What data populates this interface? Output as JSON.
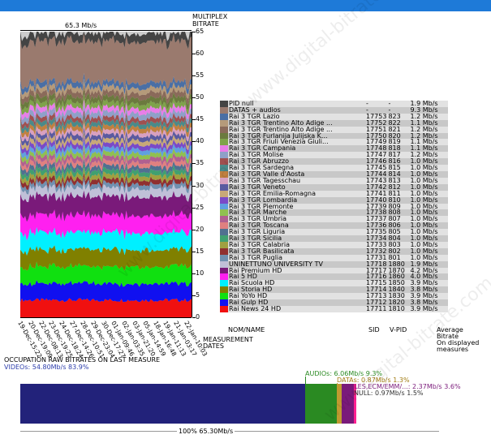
{
  "peak": "65.3 Mb/s",
  "chart_title": [
    "MULTIPLEX",
    "BITRATE"
  ],
  "y_ticks": [
    "0",
    "5",
    "10",
    "15",
    "20",
    "25",
    "30",
    "35",
    "40",
    "45",
    "50",
    "55",
    "60",
    "65"
  ],
  "dates": [
    "19-Dec-15:22",
    "20-Dec-19:09",
    "22-Dec-08:13",
    "23-Dec-19:25",
    "24-Dec-18:24",
    "27-Dec-14:26",
    "28-Dec-10:51",
    "29-Dec-23:04",
    "30-Dec-17:27",
    "01-Jan-09:46",
    "02-Jan-03:35",
    "03-Jan-21:20",
    "05-Jan-14:59",
    "18-Jan-16:48",
    "19-Jan-11:13",
    "21-Jan-03:17",
    "22-Jan-10:03"
  ],
  "measurement_dates": [
    "MEASUREMENT",
    "DATES"
  ],
  "legend": [
    {
      "color": "#444444",
      "name": "PID null",
      "sid": "-",
      "vpid": "-",
      "rate": "1.9 Mb/s"
    },
    {
      "color": "#9a7a6e",
      "name": "DATAS + audios",
      "sid": "-",
      "vpid": "-",
      "rate": "9.3 Mb/s"
    },
    {
      "color": "#4a6fa5",
      "name": "Rai 3 TGR Lazio",
      "sid": "17753",
      "vpid": "823",
      "rate": "1.2 Mb/s"
    },
    {
      "color": "#b59a7a",
      "name": "Rai 3 TGR Trentino Alto Adige ...",
      "sid": "17752",
      "vpid": "822",
      "rate": "1.1 Mb/s"
    },
    {
      "color": "#8a6a5a",
      "name": "Rai 3 TGR Trentino Alto Adige ...",
      "sid": "17751",
      "vpid": "821",
      "rate": "1.2 Mb/s"
    },
    {
      "color": "#6b7a3e",
      "name": "Rai 3 TGR Furlanija Julijska K...",
      "sid": "17750",
      "vpid": "820",
      "rate": "1.2 Mb/s"
    },
    {
      "color": "#7fa34a",
      "name": "Rai 3 TGR Friuli Venezia Giuli...",
      "sid": "17749",
      "vpid": "819",
      "rate": "1.1 Mb/s"
    },
    {
      "color": "#e87ee8",
      "name": "Rai 3 TGR Campania",
      "sid": "17748",
      "vpid": "818",
      "rate": "1.1 Mb/s"
    },
    {
      "color": "#8fa0c8",
      "name": "Rai 3 TGR Molise",
      "sid": "17747",
      "vpid": "817",
      "rate": "1.2 Mb/s"
    },
    {
      "color": "#a05050",
      "name": "Rai 3 TGR Abruzzo",
      "sid": "17746",
      "vpid": "816",
      "rate": "1.0 Mb/s"
    },
    {
      "color": "#4a8a8a",
      "name": "Rai 3 TGR Sardegna",
      "sid": "17745",
      "vpid": "815",
      "rate": "1.0 Mb/s"
    },
    {
      "color": "#c08040",
      "name": "Rai 3 TGR Valle d'Aosta",
      "sid": "17744",
      "vpid": "814",
      "rate": "1.0 Mb/s"
    },
    {
      "color": "#d8a0c0",
      "name": "Rai 3 TGR Tagesschau",
      "sid": "17743",
      "vpid": "813",
      "rate": "1.0 Mb/s"
    },
    {
      "color": "#5a5aa0",
      "name": "Rai 3 TGR Veneto",
      "sid": "17742",
      "vpid": "812",
      "rate": "1.0 Mb/s"
    },
    {
      "color": "#c8a878",
      "name": "Rai 3 TGR Emilia-Romagna",
      "sid": "17741",
      "vpid": "811",
      "rate": "1.0 Mb/s"
    },
    {
      "color": "#7a4ac8",
      "name": "Rai 3 TGR Lombardia",
      "sid": "17740",
      "vpid": "810",
      "rate": "1.0 Mb/s"
    },
    {
      "color": "#60a0e0",
      "name": "Rai 3 TGR Piemonte",
      "sid": "17739",
      "vpid": "809",
      "rate": "1.0 Mb/s"
    },
    {
      "color": "#90c050",
      "name": "Rai 3 TGR Marche",
      "sid": "17738",
      "vpid": "808",
      "rate": "1.0 Mb/s"
    },
    {
      "color": "#b06090",
      "name": "Rai 3 TGR Umbria",
      "sid": "17737",
      "vpid": "807",
      "rate": "1.0 Mb/s"
    },
    {
      "color": "#e08080",
      "name": "Rai 3 TGR Toscana",
      "sid": "17736",
      "vpid": "806",
      "rate": "1.0 Mb/s"
    },
    {
      "color": "#507090",
      "name": "Rai 3 TGR Liguria",
      "sid": "17735",
      "vpid": "805",
      "rate": "1.0 Mb/s"
    },
    {
      "color": "#40a070",
      "name": "Rai 3 TGR Sicilia",
      "sid": "17734",
      "vpid": "804",
      "rate": "1.0 Mb/s"
    },
    {
      "color": "#a0a040",
      "name": "Rai 3 TGR Calabria",
      "sid": "17733",
      "vpid": "803",
      "rate": "1.0 Mb/s"
    },
    {
      "color": "#903030",
      "name": "Rai 3 TGR Basilicata",
      "sid": "17732",
      "vpid": "802",
      "rate": "1.0 Mb/s"
    },
    {
      "color": "#7090b0",
      "name": "Rai 3 TGR Puglia",
      "sid": "17731",
      "vpid": "801",
      "rate": "1.0 Mb/s"
    },
    {
      "color": "#c0c0d8",
      "name": "UNINETTUNO UNIVERSITY TV",
      "sid": "17718",
      "vpid": "1880",
      "rate": "1.9 Mb/s"
    },
    {
      "color": "#7a1a7a",
      "name": "Rai Premium HD",
      "sid": "17717",
      "vpid": "1870",
      "rate": "4.2 Mb/s"
    },
    {
      "color": "#ff20f0",
      "name": "Rai 5 HD",
      "sid": "17716",
      "vpid": "1860",
      "rate": "4.0 Mb/s"
    },
    {
      "color": "#00f0ff",
      "name": "Rai Scuola HD",
      "sid": "17715",
      "vpid": "1850",
      "rate": "3.9 Mb/s"
    },
    {
      "color": "#808000",
      "name": "Rai Storia HD",
      "sid": "17714",
      "vpid": "1840",
      "rate": "3.8 Mb/s"
    },
    {
      "color": "#10e010",
      "name": "Rai YoYo HD",
      "sid": "17713",
      "vpid": "1830",
      "rate": "3.9 Mb/s"
    },
    {
      "color": "#1010f0",
      "name": "Rai Gulp HD",
      "sid": "17712",
      "vpid": "1820",
      "rate": "3.8 Mb/s"
    },
    {
      "color": "#f01010",
      "name": "Rai News 24 HD",
      "sid": "17711",
      "vpid": "1810",
      "rate": "3.9 Mb/s"
    }
  ],
  "footer": {
    "nom": "NOM/NAME",
    "sid": "SID",
    "vpid": "V-PID",
    "avg": [
      "Average",
      "Bitrate",
      "On displayed",
      "measures"
    ]
  },
  "occupation": {
    "title": "OCCUPATION RAW BITRATES ON LAST MEASURE",
    "videos": "VIDEOs: 54.80Mb/s  83.9%",
    "audios": "AUDIOs: 6.06Mb/s  9.3%",
    "datas": "DATAs: 0.87Mb/s  1.3%",
    "tables": "TABLES,ECM/EMM/...: 2.37Mb/s  3.6%",
    "null": "NULL: 0.97Mb/s  1.5%",
    "total": "100%  65.30Mb/s",
    "colors": {
      "videos": "#22227a",
      "audios": "#2a8a22",
      "datas": "#c09a30",
      "tables": "#7a1a7a",
      "null": "#ff2090"
    }
  },
  "watermark": "www.digital-bitrate.com"
}
